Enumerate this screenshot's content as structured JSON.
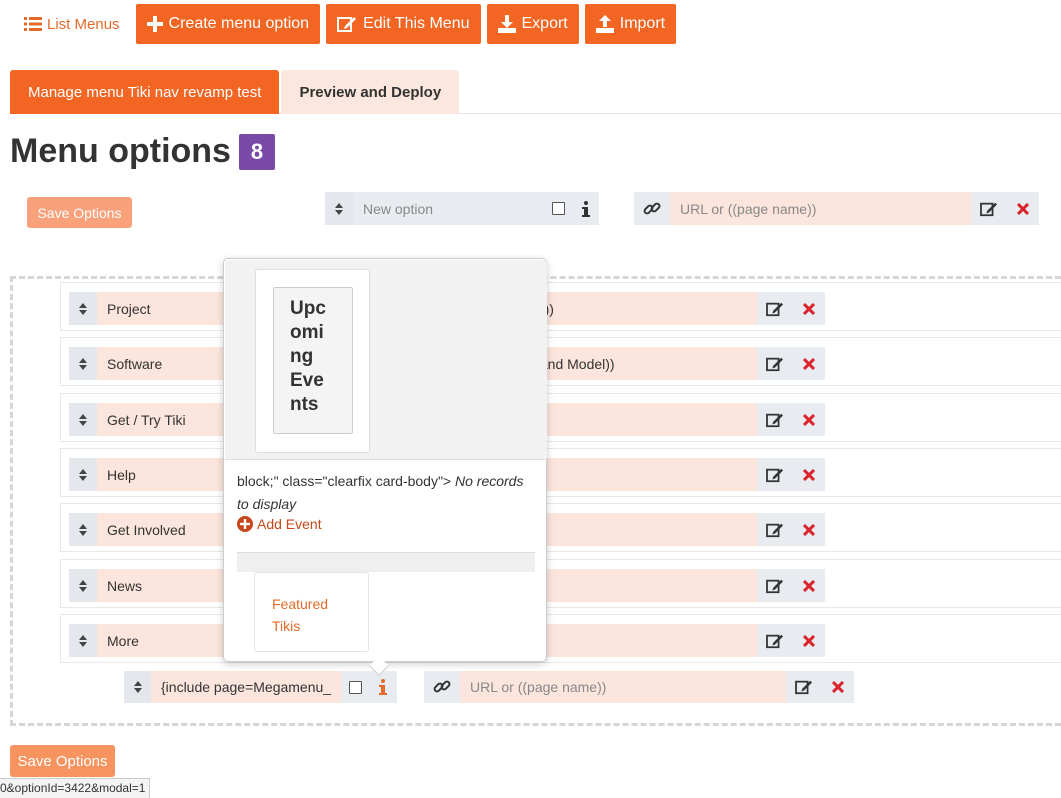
{
  "toolbar": {
    "list_menus": "List Menus",
    "create_option": "Create menu option",
    "edit_menu": "Edit This Menu",
    "export": "Export",
    "import": "Import"
  },
  "tabs": [
    {
      "label": "Manage menu Tiki nav revamp test"
    },
    {
      "label": "Preview and Deploy"
    }
  ],
  "page_title": "Menu options",
  "option_count": "8",
  "save_options": "Save Options",
  "new_option": {
    "name_placeholder": "New option",
    "url_placeholder": "URL or ((page name))"
  },
  "menu_rows": [
    {
      "label": "Project",
      "url_tail": "on))"
    },
    {
      "label": "Software",
      "url_tail": "v and Model))"
    },
    {
      "label": "Get / Try Tiki",
      "url_tail": ""
    },
    {
      "label": "Help",
      "url_tail": ""
    },
    {
      "label": "Get Involved",
      "url_tail": ""
    },
    {
      "label": "News",
      "url_tail": ""
    },
    {
      "label": "More",
      "url_tail": ""
    }
  ],
  "child_row": {
    "label": "{include page=Megamenu_",
    "url_placeholder": "URL or ((page name))"
  },
  "popover": {
    "card_title_lines": [
      "Upc",
      "omi",
      "ng",
      "Eve",
      "nts"
    ],
    "html_fragment": "block;\" class=\"clearfix card-body\">",
    "no_records": "No records to display",
    "add_event": "Add Event",
    "featured_lines": [
      "Featured",
      "Tikis"
    ]
  },
  "status_url": "0&optionId=3422&modal=1",
  "colors": {
    "accent": "#f26522",
    "badge": "#7a4aa8",
    "delete": "#d9232d",
    "field": "#fbe5dd"
  },
  "icons": [
    "list-icon",
    "plus-icon",
    "edit-icon",
    "download-icon",
    "upload-icon",
    "sort-icon",
    "info-icon",
    "link-icon",
    "delete-icon",
    "plus-circle-icon"
  ]
}
